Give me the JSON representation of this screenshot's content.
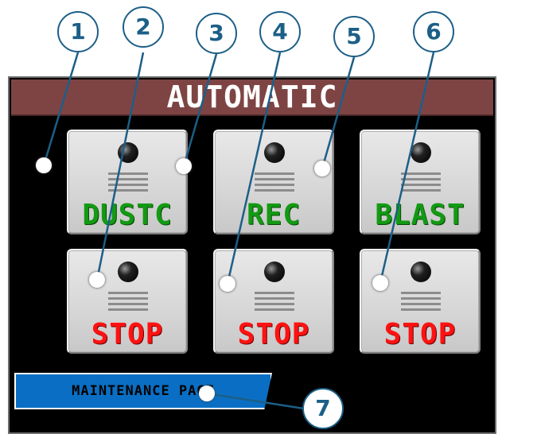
{
  "title": "AUTOMATIC",
  "buttons": [
    {
      "label": "DUSTC",
      "state": "run"
    },
    {
      "label": "REC",
      "state": "run"
    },
    {
      "label": "BLAST",
      "state": "run"
    },
    {
      "label": "STOP",
      "state": "stop"
    },
    {
      "label": "STOP",
      "state": "stop"
    },
    {
      "label": "STOP",
      "state": "stop"
    }
  ],
  "maintenance_button": "MAINTENANCE PAGE",
  "callouts": [
    "1",
    "2",
    "3",
    "4",
    "5",
    "6",
    "7"
  ],
  "colors": {
    "title_bar": "#7e4444",
    "run_label": "#139a13",
    "stop_label": "#ff1212",
    "maintenance_bg": "#0a6fc4",
    "callout": "#1c5f87"
  }
}
